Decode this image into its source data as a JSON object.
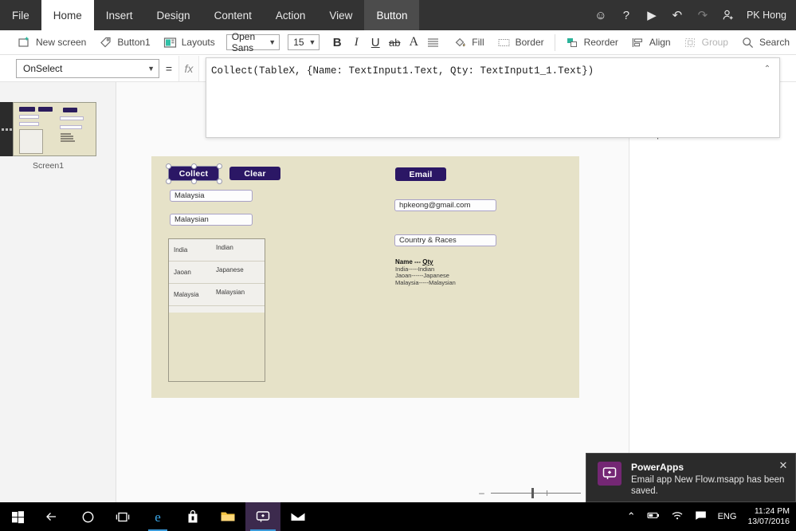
{
  "tabbar": {
    "tabs": [
      {
        "label": "File",
        "state": "normal"
      },
      {
        "label": "Home",
        "state": "active"
      },
      {
        "label": "Insert",
        "state": "normal"
      },
      {
        "label": "Design",
        "state": "normal"
      },
      {
        "label": "Content",
        "state": "normal"
      },
      {
        "label": "Action",
        "state": "normal"
      },
      {
        "label": "View",
        "state": "normal"
      },
      {
        "label": "Button",
        "state": "contextual"
      }
    ],
    "icons": {
      "smiley": "☺",
      "help": "?",
      "play": "▶",
      "undo": "↶",
      "redo": "↷",
      "account": "people-icon"
    },
    "user": "PK Hong"
  },
  "ribbon": {
    "new_screen": "New screen",
    "button_name": "Button1",
    "layouts": "Layouts",
    "font_family": "Open Sans",
    "font_size": "15",
    "bold": "B",
    "italic": "I",
    "underline": "U",
    "strikethrough": "ab",
    "text_color": "A",
    "align": "align-icon",
    "fill": "Fill",
    "border": "Border",
    "reorder": "Reorder",
    "align_label": "Align",
    "group": "Group",
    "search": "Search"
  },
  "formula": {
    "property": "OnSelect",
    "equals": "=",
    "fx": "fx",
    "expression": "Collect(TableX, {Name: TextInput1.Text, Qty: TextInput1_1.Text})",
    "collapse": "⌃"
  },
  "left_pane": {
    "screen_label": "Screen1"
  },
  "right_pane": {
    "message": "No options are available."
  },
  "app": {
    "collect_button": "Collect",
    "clear_button": "Clear",
    "email_button": "Email",
    "input_country": "Malaysia",
    "input_race": "Malaysian",
    "input_email": "hpkeong@gmail.com",
    "input_subject": "Country & Races",
    "gallery": [
      {
        "name": "India",
        "qty": "Indian"
      },
      {
        "name": "Jaoan",
        "qty": "Japanese"
      },
      {
        "name": "Malaysia",
        "qty": "Malaysian"
      }
    ],
    "summary_header_a": "Name ---",
    "summary_header_b": "Qty",
    "summary_rows": [
      "India-----Indian",
      "Jaoan------Japanese",
      "Malaysia-----Malaysian"
    ]
  },
  "zoom_slider": {
    "minus": "–",
    "plus": "+"
  },
  "toast": {
    "title": "PowerApps",
    "message": "Email app New Flow.msapp has been saved.",
    "close": "✕"
  },
  "taskbar": {
    "items": [
      {
        "name": "start-button",
        "glyph": "⊞"
      },
      {
        "name": "back-button",
        "glyph": "←"
      },
      {
        "name": "cortana-button",
        "glyph": "◯"
      },
      {
        "name": "task-view-button",
        "glyph": "❐"
      },
      {
        "name": "edge-icon",
        "glyph": "e"
      },
      {
        "name": "store-icon",
        "glyph": "shopping-bag"
      },
      {
        "name": "file-explorer-icon",
        "glyph": "folder"
      },
      {
        "name": "powerapps-icon",
        "glyph": "powerapps"
      },
      {
        "name": "mail-icon",
        "glyph": "envelope"
      }
    ],
    "tray": {
      "chevron": "⌃",
      "battery": "battery-icon",
      "wifi": "wifi-icon",
      "action_center": "action-center-icon",
      "language": "ENG",
      "time": "11:24 PM",
      "date": "13/07/2016"
    }
  }
}
